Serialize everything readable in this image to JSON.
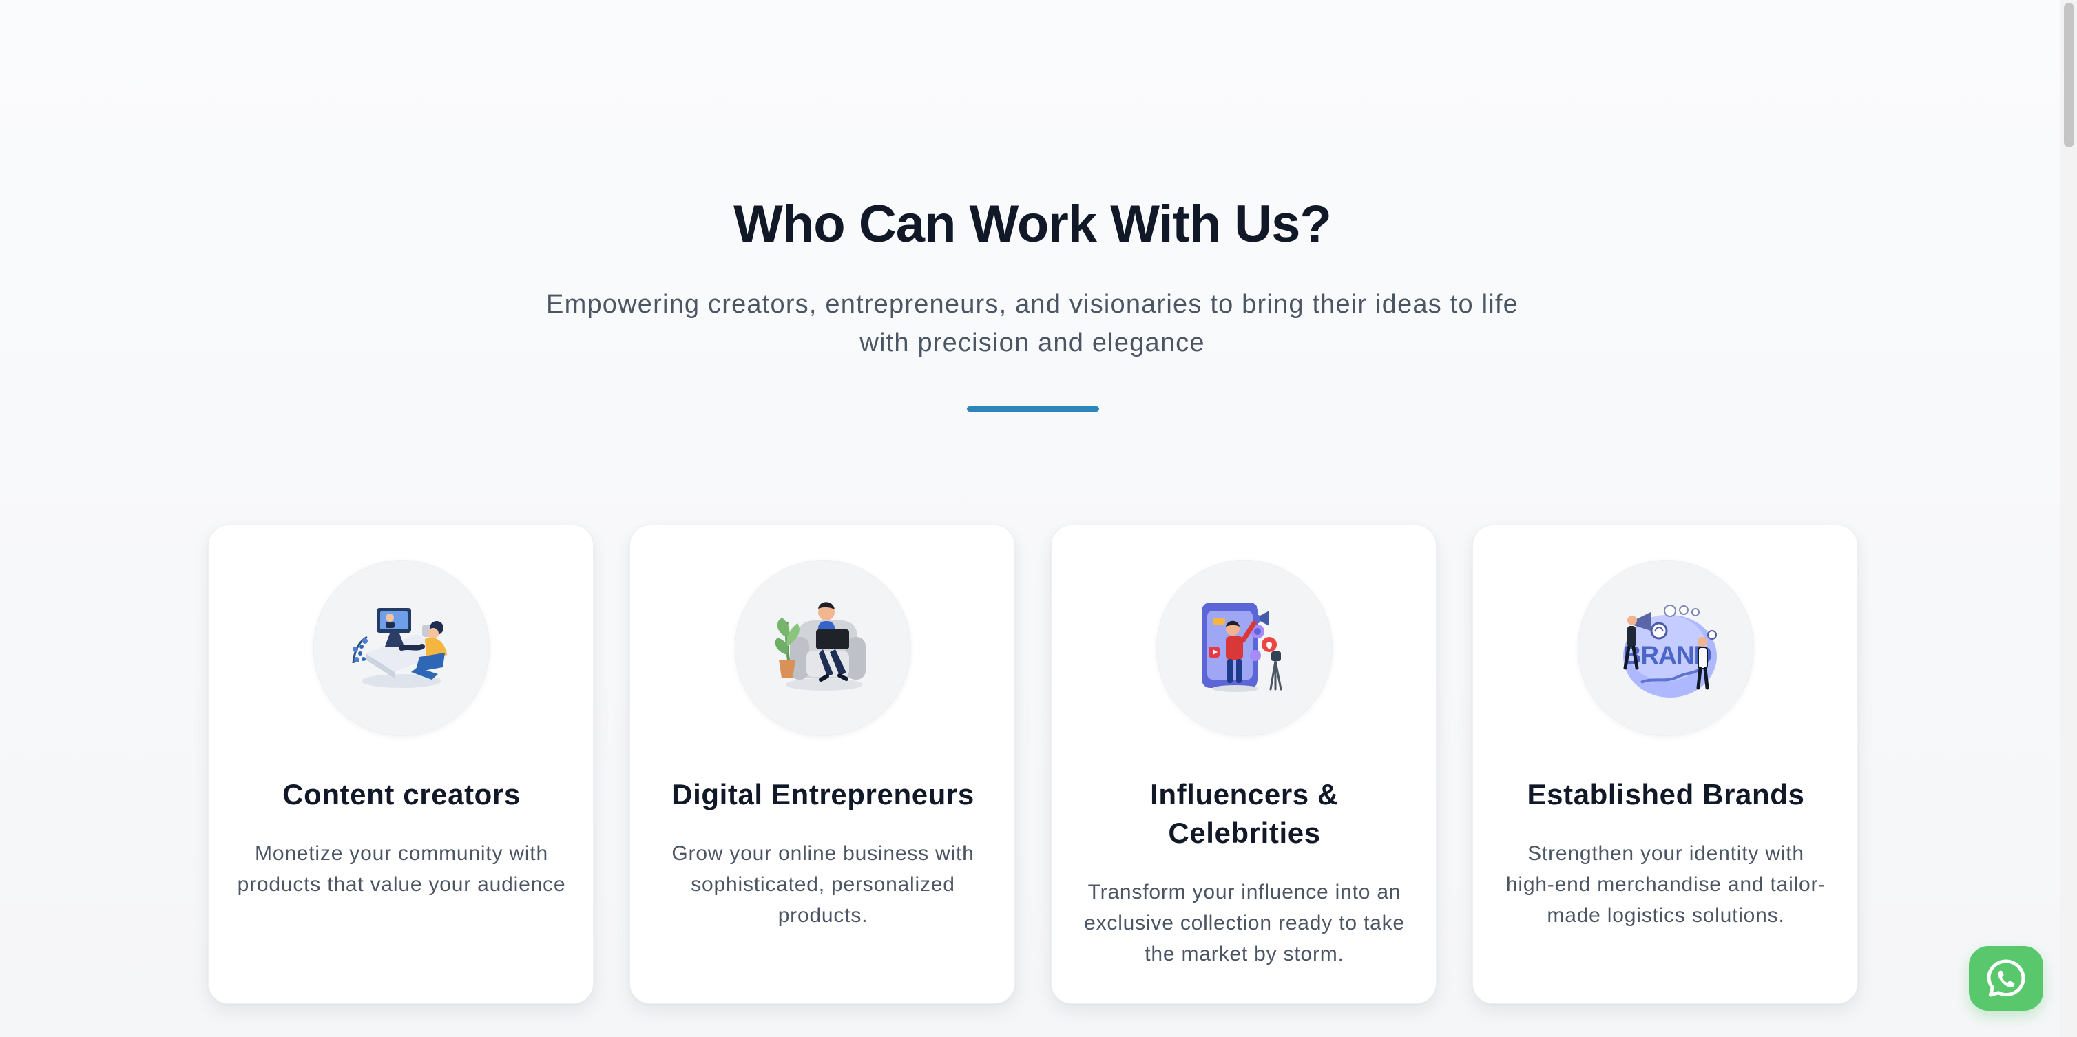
{
  "section": {
    "title": "Who Can Work With Us?",
    "subtitle": "Empowering creators, entrepreneurs, and visionaries to bring their ideas to life with precision and elegance"
  },
  "cards": [
    {
      "icon": "content-creator-illustration",
      "title": "Content creators",
      "description": "Monetize your community with products that value your audience"
    },
    {
      "icon": "digital-entrepreneur-illustration",
      "title": "Digital Entrepreneurs",
      "description": "Grow your online business with sophisticated, personalized products."
    },
    {
      "icon": "influencer-celebrity-illustration",
      "title": "Influencers & Celebrities",
      "description": "Transform your influence into an exclusive collection ready to take the market by storm."
    },
    {
      "icon": "established-brands-illustration",
      "title": "Established Brands",
      "description": "Strengthen your identity with high-end merchandise and tailor-made logistics solutions."
    }
  ],
  "illustration_text": {
    "brand": "BRAND"
  },
  "floating_action": {
    "icon": "whatsapp-icon"
  },
  "colors": {
    "background": "#fafbfc",
    "title": "#111827",
    "subtitle": "#4b5563",
    "accent": "#2e86b8",
    "card": "#ffffff",
    "icon_circle": "#f3f4f6",
    "whatsapp": "#59c86d"
  }
}
